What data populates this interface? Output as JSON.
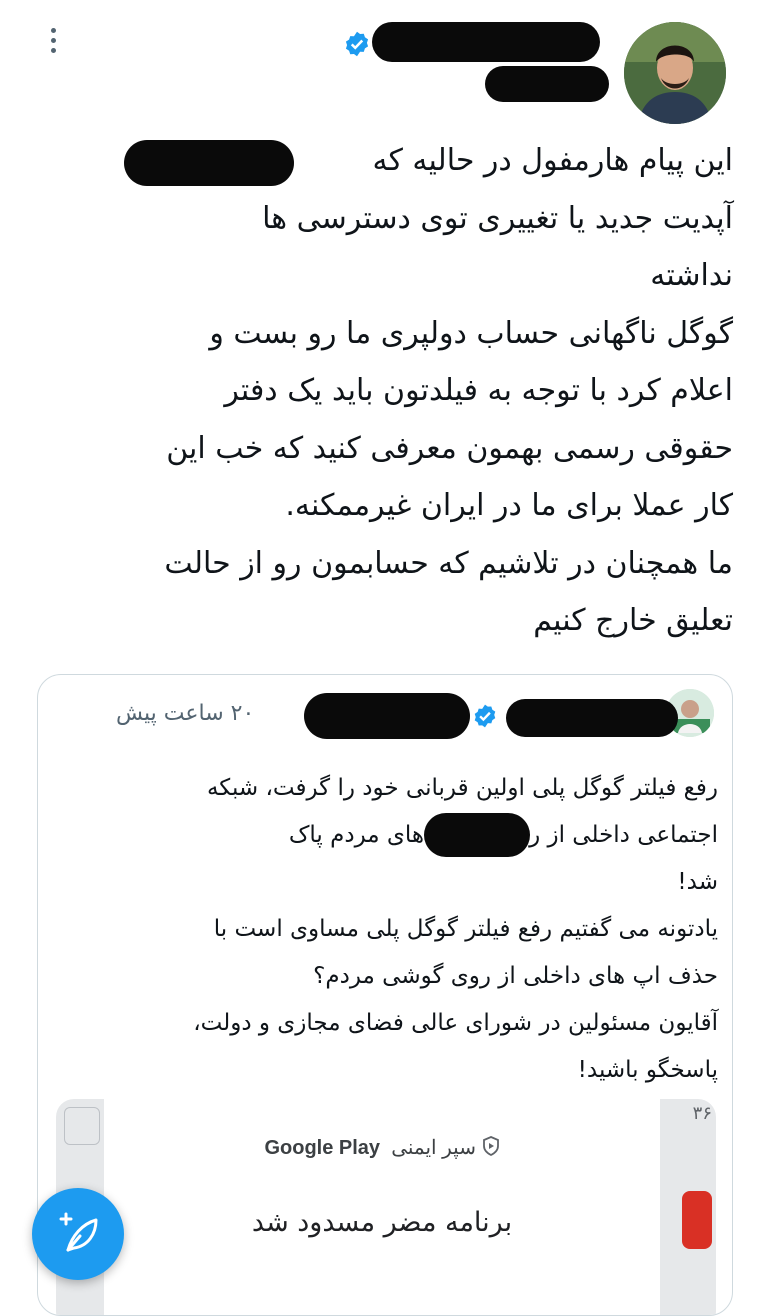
{
  "colors": {
    "accent": "#1d9bf0",
    "secondary_text": "#536471",
    "border": "#cfd9de"
  },
  "tweet": {
    "lines": [
      "این پیام هارمفول در حالیه که",
      "آپدیت جدید یا تغییری توی دسترسی ها",
      "نداشته",
      "گوگل ناگهانی حساب دولپری ما رو بست و",
      "اعلام کرد با توجه به فیلدتون باید یک دفتر",
      "حقوقی رسمی بهمون معرفی کنید که خب این",
      "کار عملا برای ما در ایران غیرممکنه.",
      "ما همچنان در تلاشیم که حسابمون رو از حالت",
      "تعلیق خارج کنیم"
    ]
  },
  "quote": {
    "time": "۲۰ ساعت پیش",
    "lines": [
      "رفع فیلتر گوگل پلی اولین قربانی خود را گرفت، شبکه",
      "اجتماعی داخلی                 از روی گوشی های مردم پاک",
      "شد!",
      "یادتونه می گفتیم رفع فیلتر گوگل پلی مساوی است با",
      "حذف اپ های داخلی از روی گوشی مردم؟",
      " آقایون مسئولین در شورای عالی فضای مجازی و دولت،",
      "پاسخگو باشید!"
    ],
    "media": {
      "google_play_shield": "سپر ایمنی",
      "google_play": "Google Play",
      "headline": "برنامه مضر مسدود شد",
      "corner_number": "۳۶"
    }
  },
  "icons": {
    "more": "more-vertical-icon",
    "verified": "verified-badge-icon",
    "shield": "play-protect-shield-icon",
    "compose": "compose-feather-icon"
  }
}
